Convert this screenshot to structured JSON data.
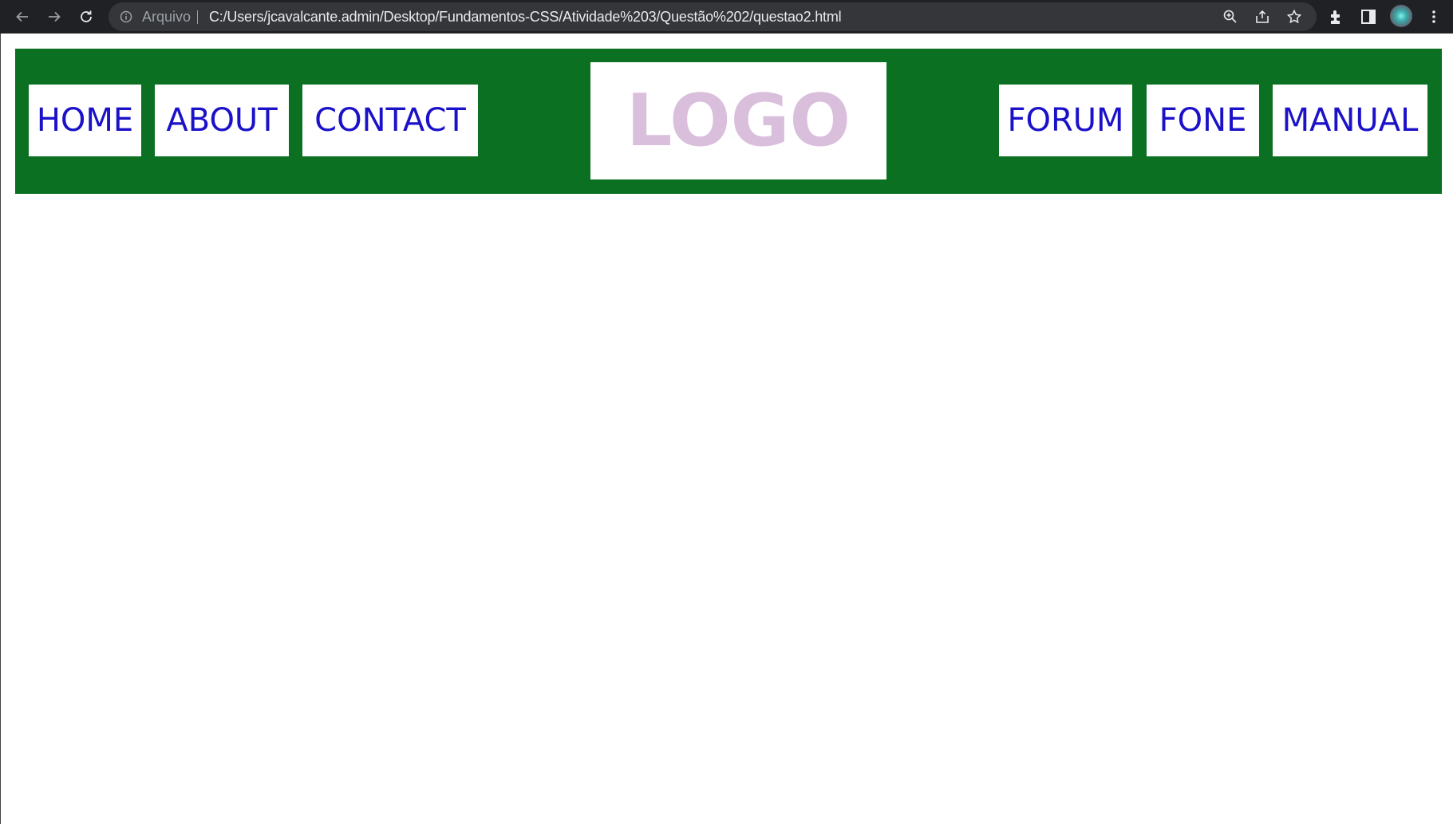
{
  "browser": {
    "security_label": "Arquivo",
    "url": "C:/Users/jcavalcante.admin/Desktop/Fundamentos-CSS/Atividade%203/Questão%202/questao2.html"
  },
  "header": {
    "left_nav": [
      "HOME",
      "ABOUT",
      "CONTACT"
    ],
    "logo_text": "LOGO",
    "right_nav": [
      "FORUM",
      "FONE",
      "MANUAL"
    ]
  },
  "colors": {
    "header_bg": "#0b7021",
    "nav_text": "#1a11c9",
    "logo_text": "#d9bfdc",
    "toolbar_bg": "#202124"
  }
}
